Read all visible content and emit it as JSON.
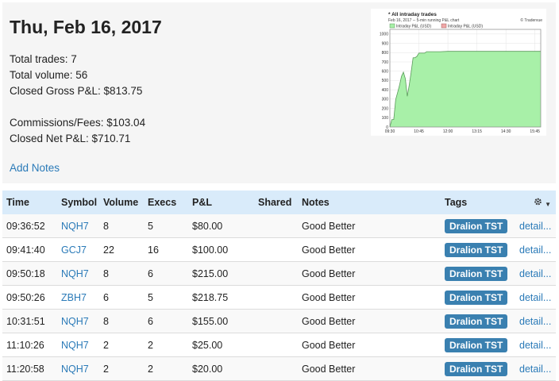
{
  "summary": {
    "date": "Thu, Feb 16, 2017",
    "total_trades": "Total trades: 7",
    "total_volume": "Total volume: 56",
    "closed_gross": "Closed Gross P&L: $813.75",
    "commissions": "Commissions/Fees: $103.04",
    "closed_net": "Closed Net P&L: $710.71",
    "add_notes": "Add Notes"
  },
  "chart_data": {
    "type": "area",
    "title": "* All intraday trades",
    "subtitle": "Feb 16, 2017 -- 5-min running P&L chart",
    "watermark": "© Tradervue",
    "legend": [
      "Intraday P&L (USD)",
      "Intraday P&L (USD)"
    ],
    "x_ticks": [
      "09:30",
      "10:45",
      "12:00",
      "13:15",
      "14:30",
      "15:45"
    ],
    "y_ticks": [
      0,
      100,
      200,
      300,
      400,
      500,
      600,
      700,
      800,
      900,
      1000
    ],
    "ylim": [
      0,
      1050
    ],
    "x_minutes_range": [
      570,
      960
    ],
    "series": [
      {
        "x_minutes": [
          570,
          575,
          580,
          585,
          590,
          595,
          600,
          605,
          610,
          615,
          620,
          625,
          630,
          635,
          640,
          645,
          650,
          655,
          660,
          665,
          670,
          675,
          680,
          690,
          700,
          720,
          960
        ],
        "y": [
          0,
          80,
          80,
          295,
          370,
          450,
          545,
          590,
          520,
          330,
          450,
          590,
          745,
          745,
          760,
          795,
          795,
          795,
          795,
          810,
          810,
          810,
          810,
          810,
          810,
          813.75,
          813.75
        ]
      }
    ],
    "colors": {
      "fill": "#a8f0a8",
      "line": "#5a9a5a",
      "loss_fill": "#f0a8a8"
    }
  },
  "table": {
    "headers": {
      "time": "Time",
      "symbol": "Symbol",
      "volume": "Volume",
      "execs": "Execs",
      "pnl": "P&L",
      "shared": "Shared",
      "notes": "Notes",
      "tags": "Tags"
    },
    "rows": [
      {
        "time": "09:36:52",
        "symbol": "NQH7",
        "volume": "8",
        "execs": "5",
        "pnl": "$80.00",
        "notes": "Good Better",
        "tag": "Dralion TST",
        "details": "detail..."
      },
      {
        "time": "09:41:40",
        "symbol": "GCJ7",
        "volume": "22",
        "execs": "16",
        "pnl": "$100.00",
        "notes": "Good Better",
        "tag": "Dralion TST",
        "details": "detail..."
      },
      {
        "time": "09:50:18",
        "symbol": "NQH7",
        "volume": "8",
        "execs": "6",
        "pnl": "$215.00",
        "notes": "Good Better",
        "tag": "Dralion TST",
        "details": "detail..."
      },
      {
        "time": "09:50:26",
        "symbol": "ZBH7",
        "volume": "6",
        "execs": "5",
        "pnl": "$218.75",
        "notes": "Good Better",
        "tag": "Dralion TST",
        "details": "detail..."
      },
      {
        "time": "10:31:51",
        "symbol": "NQH7",
        "volume": "8",
        "execs": "6",
        "pnl": "$155.00",
        "notes": "Good Better",
        "tag": "Dralion TST",
        "details": "detail..."
      },
      {
        "time": "11:10:26",
        "symbol": "NQH7",
        "volume": "2",
        "execs": "2",
        "pnl": "$25.00",
        "notes": "Good Better",
        "tag": "Dralion TST",
        "details": "detail..."
      },
      {
        "time": "11:20:58",
        "symbol": "NQH7",
        "volume": "2",
        "execs": "2",
        "pnl": "$20.00",
        "notes": "Good Better",
        "tag": "Dralion TST",
        "details": "detail..."
      }
    ]
  }
}
